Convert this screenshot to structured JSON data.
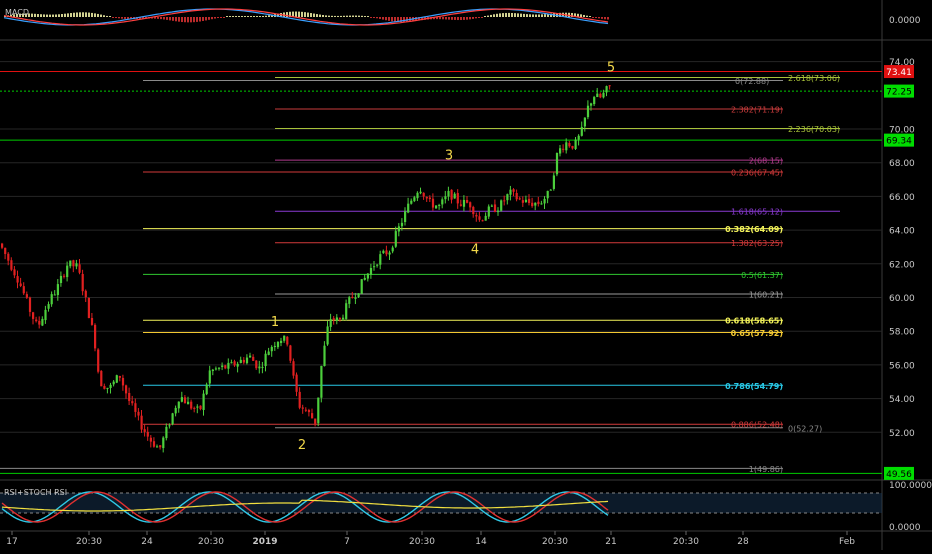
{
  "macd_panel": {
    "label": "MACD",
    "axis_label": "0.0000"
  },
  "rsi_panel": {
    "label": "RSI+STOCH RSI",
    "axis_labels": [
      "100.0000",
      "0.0000"
    ]
  },
  "chart_data": {
    "type": "candlestick",
    "y_ticks": [
      52.0,
      54.0,
      56.0,
      58.0,
      60.0,
      62.0,
      64.0,
      66.0,
      68.0,
      70.0,
      74.0
    ],
    "y_tick_labels": [
      "52.00",
      "54.00",
      "56.00",
      "58.00",
      "60.00",
      "62.00",
      "64.00",
      "66.00",
      "68.00",
      "70.00",
      "74.00"
    ],
    "x_tick_labels": [
      "17",
      "20:30",
      "24",
      "20:30",
      "2019",
      "7",
      "20:30",
      "14",
      "20:30",
      "21",
      "20:30",
      "28",
      "Feb"
    ],
    "price_badges": [
      {
        "text": "73.41",
        "value": 73.41,
        "bg": "#e01010",
        "fg": "#ffffff"
      },
      {
        "text": "72.25",
        "value": 72.25,
        "bg": "#00dd00",
        "fg": "#000000"
      },
      {
        "text": "69.34",
        "value": 69.34,
        "bg": "#00dd00",
        "fg": "#000000"
      },
      {
        "text": "49.56",
        "value": 49.56,
        "bg": "#00dd00",
        "fg": "#000000"
      }
    ],
    "horizontal_lines": [
      {
        "value": 73.41,
        "color": "#e01010"
      },
      {
        "value": 72.25,
        "color": "#00cc00",
        "dashed": true
      },
      {
        "value": 69.34,
        "color": "#00cc00"
      },
      {
        "value": 49.56,
        "color": "#00cc00"
      }
    ],
    "fib_levels": [
      {
        "text": "0(72.88)",
        "value": 72.88,
        "color": "#8a8a8a"
      },
      {
        "text": "2.618(73.06)",
        "value": 73.06,
        "color": "#a8c23a"
      },
      {
        "text": "2.382(71.19)",
        "value": 71.19,
        "color": "#c83c3c"
      },
      {
        "text": "2.236(70.03)",
        "value": 70.03,
        "color": "#a8c23a"
      },
      {
        "text": "2(68.15)",
        "value": 68.15,
        "color": "#b03a8c"
      },
      {
        "text": "0.236(67.45)",
        "value": 67.45,
        "color": "#d23a3a"
      },
      {
        "text": "1.618(65.12)",
        "value": 65.12,
        "color": "#8a3ad2"
      },
      {
        "text": "0.382(64.09)",
        "value": 64.09,
        "color": "#f2f25a"
      },
      {
        "text": "1.382(63.25)",
        "value": 63.25,
        "color": "#d23a3a"
      },
      {
        "text": "0.5(61.37)",
        "value": 61.37,
        "color": "#30c830"
      },
      {
        "text": "1(60.21)",
        "value": 60.21,
        "color": "#9a9a9a"
      },
      {
        "text": "0.618(58.65)",
        "value": 58.65,
        "color": "#f2f25a"
      },
      {
        "text": "0.65(57.92)",
        "value": 57.92,
        "color": "#f2c832"
      },
      {
        "text": "0.786(54.79)",
        "value": 54.79,
        "color": "#28c8e6"
      },
      {
        "text": "0.886(52.48)",
        "value": 52.48,
        "color": "#d23a3a"
      },
      {
        "text": "0(52.27)",
        "value": 52.27,
        "color": "#8a8a8a"
      },
      {
        "text": "1(49.86)",
        "value": 49.86,
        "color": "#8a8a8a"
      }
    ],
    "wave_labels": [
      {
        "text": "1",
        "value": 58.6
      },
      {
        "text": "2",
        "value": 51.3
      },
      {
        "text": "3",
        "value": 68.5
      },
      {
        "text": "4",
        "value": 62.9
      },
      {
        "text": "5",
        "value": 73.7
      }
    ],
    "anchors": [
      {
        "x": 0,
        "y": 63.2
      },
      {
        "x": 10,
        "y": 62.1
      },
      {
        "x": 20,
        "y": 60.9
      },
      {
        "x": 30,
        "y": 59.3
      },
      {
        "x": 38,
        "y": 58.2
      },
      {
        "x": 48,
        "y": 59.6
      },
      {
        "x": 58,
        "y": 60.6
      },
      {
        "x": 68,
        "y": 62.0
      },
      {
        "x": 78,
        "y": 61.8
      },
      {
        "x": 88,
        "y": 59.4
      },
      {
        "x": 95,
        "y": 57.5
      },
      {
        "x": 100,
        "y": 55.0
      },
      {
        "x": 110,
        "y": 54.6
      },
      {
        "x": 120,
        "y": 55.4
      },
      {
        "x": 130,
        "y": 53.8
      },
      {
        "x": 140,
        "y": 52.6
      },
      {
        "x": 150,
        "y": 51.6
      },
      {
        "x": 160,
        "y": 51.0
      },
      {
        "x": 170,
        "y": 52.6
      },
      {
        "x": 180,
        "y": 54.2
      },
      {
        "x": 190,
        "y": 53.6
      },
      {
        "x": 200,
        "y": 53.2
      },
      {
        "x": 210,
        "y": 55.6
      },
      {
        "x": 220,
        "y": 55.8
      },
      {
        "x": 230,
        "y": 55.9
      },
      {
        "x": 240,
        "y": 56.2
      },
      {
        "x": 250,
        "y": 56.5
      },
      {
        "x": 260,
        "y": 55.8
      },
      {
        "x": 270,
        "y": 57.0
      },
      {
        "x": 280,
        "y": 57.6
      },
      {
        "x": 288,
        "y": 57.4
      },
      {
        "x": 295,
        "y": 54.8
      },
      {
        "x": 300,
        "y": 53.6
      },
      {
        "x": 308,
        "y": 53.2
      },
      {
        "x": 316,
        "y": 52.6
      },
      {
        "x": 322,
        "y": 56.0
      },
      {
        "x": 330,
        "y": 58.8
      },
      {
        "x": 340,
        "y": 58.6
      },
      {
        "x": 350,
        "y": 59.8
      },
      {
        "x": 360,
        "y": 60.6
      },
      {
        "x": 370,
        "y": 61.6
      },
      {
        "x": 380,
        "y": 62.4
      },
      {
        "x": 390,
        "y": 62.8
      },
      {
        "x": 400,
        "y": 64.2
      },
      {
        "x": 410,
        "y": 65.6
      },
      {
        "x": 420,
        "y": 66.6
      },
      {
        "x": 430,
        "y": 65.6
      },
      {
        "x": 440,
        "y": 65.4
      },
      {
        "x": 450,
        "y": 66.2
      },
      {
        "x": 460,
        "y": 65.6
      },
      {
        "x": 470,
        "y": 65.6
      },
      {
        "x": 480,
        "y": 64.6
      },
      {
        "x": 490,
        "y": 65.2
      },
      {
        "x": 500,
        "y": 65.4
      },
      {
        "x": 510,
        "y": 66.2
      },
      {
        "x": 520,
        "y": 65.8
      },
      {
        "x": 530,
        "y": 65.6
      },
      {
        "x": 540,
        "y": 65.6
      },
      {
        "x": 550,
        "y": 66.2
      },
      {
        "x": 558,
        "y": 68.6
      },
      {
        "x": 566,
        "y": 69.2
      },
      {
        "x": 575,
        "y": 69.0
      },
      {
        "x": 582,
        "y": 69.8
      },
      {
        "x": 588,
        "y": 71.2
      },
      {
        "x": 594,
        "y": 72.0
      },
      {
        "x": 600,
        "y": 71.8
      },
      {
        "x": 606,
        "y": 72.2
      },
      {
        "x": 609,
        "y": 72.5
      }
    ]
  },
  "colors": {
    "bull": "#4ccf3c",
    "bear": "#e02020",
    "axis_text": "#c8c8c8",
    "grid": "#262626",
    "wave_label": "#f2d84a"
  }
}
